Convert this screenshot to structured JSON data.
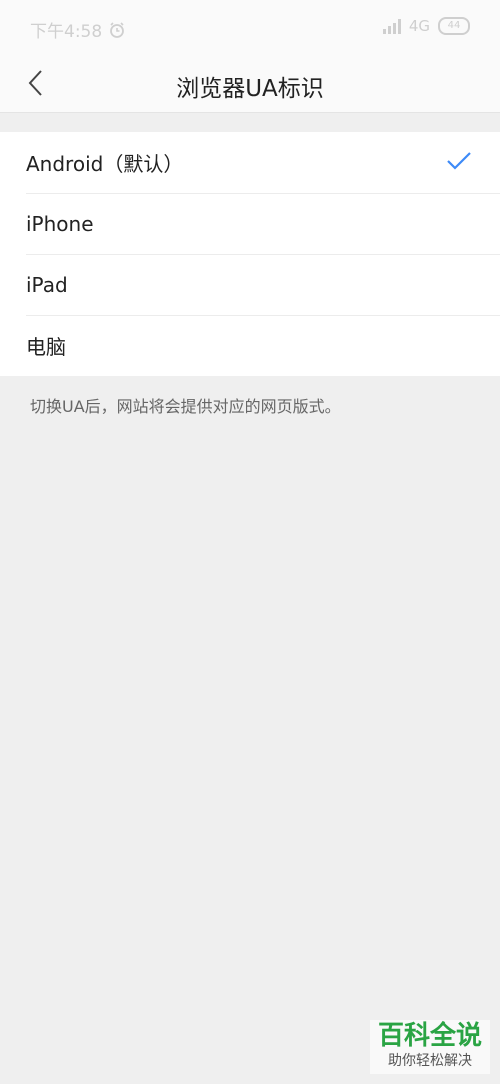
{
  "status_bar": {
    "time": "下午4:58",
    "network": "4G",
    "battery": "44"
  },
  "header": {
    "title": "浏览器UA标识"
  },
  "options": [
    {
      "label": "Android（默认）",
      "selected": true
    },
    {
      "label": "iPhone",
      "selected": false
    },
    {
      "label": "iPad",
      "selected": false
    },
    {
      "label": "电脑",
      "selected": false
    }
  ],
  "note": "切换UA后，网站将会提供对应的网页版式。",
  "watermark": {
    "title": "百科全说",
    "subtitle": "助你轻松解决"
  },
  "colors": {
    "accent": "#3d8af7",
    "background": "#efefef",
    "watermark_green": "#2aa444"
  }
}
